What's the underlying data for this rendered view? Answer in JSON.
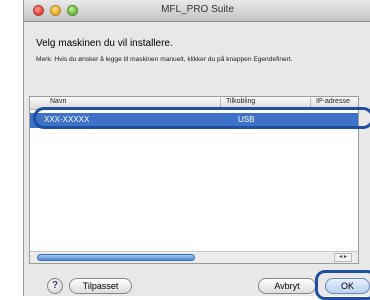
{
  "window": {
    "title": "MFL_PRO Suite"
  },
  "dialog": {
    "heading": "Velg maskinen du vil installere.",
    "note": "Merk: Hvis du ønsker å legge til maskinen manuelt, klikker du på knappen Egendefinert."
  },
  "table": {
    "columns": [
      "Navn",
      "Tilkobling",
      "IP-adresse"
    ],
    "rows": [
      {
        "name": "XXX-XXXXX",
        "connection": "USB",
        "selected": true
      }
    ],
    "scroll_arrows": "◂ ▸"
  },
  "buttons": {
    "help": "?",
    "custom": "Tilpasset",
    "cancel": "Avbryt",
    "ok": "OK"
  },
  "colors": {
    "selection": "#3e72c8",
    "callout": "#1f4fa0"
  }
}
